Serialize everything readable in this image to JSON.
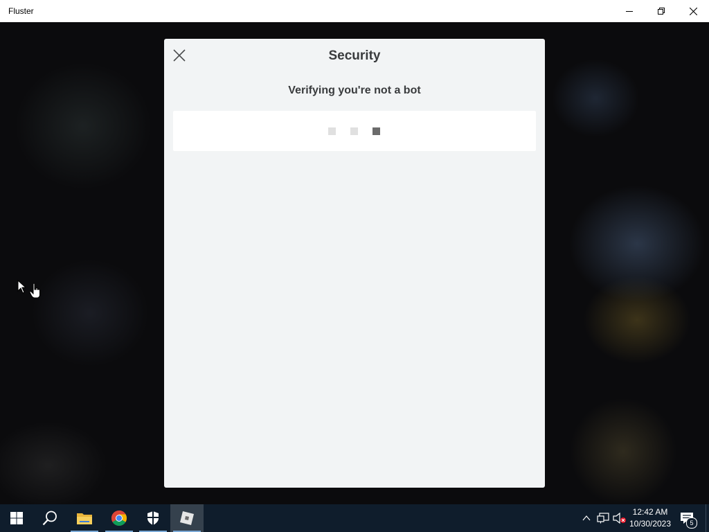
{
  "window": {
    "title": "Fluster",
    "controls": [
      "minimize-icon",
      "restore-icon",
      "close-icon"
    ]
  },
  "modal": {
    "heading": "Security",
    "subheading": "Verifying you're not a bot",
    "loading_dots": [
      {
        "state": "inactive",
        "color": "#e0e0e0"
      },
      {
        "state": "inactive",
        "color": "#e0e0e0"
      },
      {
        "state": "active",
        "color": "#6b6b6b"
      }
    ],
    "close_icon": "close-icon"
  },
  "taskbar": {
    "items": [
      {
        "name": "start-button",
        "icon": "windows-logo-icon"
      },
      {
        "name": "search-button",
        "icon": "search-icon"
      },
      {
        "name": "file-explorer",
        "icon": "folder-icon"
      },
      {
        "name": "chrome",
        "icon": "chrome-icon"
      },
      {
        "name": "windows-security",
        "icon": "shield-icon"
      },
      {
        "name": "roblox",
        "icon": "roblox-icon"
      }
    ],
    "tray": {
      "icons": [
        "chevron-up-icon",
        "network-icon",
        "volume-muted-icon"
      ],
      "time": "12:42 AM",
      "date": "10/30/2023",
      "notification_count": "5"
    }
  },
  "colors": {
    "modal_bg": "#f2f4f5",
    "text": "#393b3d",
    "taskbar": "#0f1d2c"
  }
}
